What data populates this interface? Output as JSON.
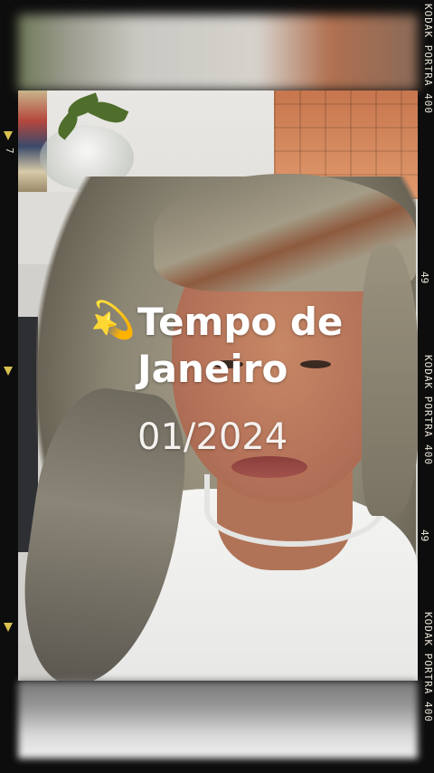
{
  "overlay": {
    "emoji": "💫",
    "title_line1": "Tempo de",
    "title_line2": "Janeiro",
    "date": "01/2024"
  },
  "film_edge": {
    "brand_top": "KODAK PORTRA 400",
    "frame_num_1": "49",
    "brand_mid": "KODAK PORTRA 400",
    "frame_num_2": "49",
    "brand_bottom": "KODAK PORTRA 400",
    "left_num": "7"
  },
  "colors": {
    "frame": "#0d0d0d",
    "edge_text": "#e8e3d6",
    "marker": "#d9c050",
    "title": "#ffffff"
  }
}
